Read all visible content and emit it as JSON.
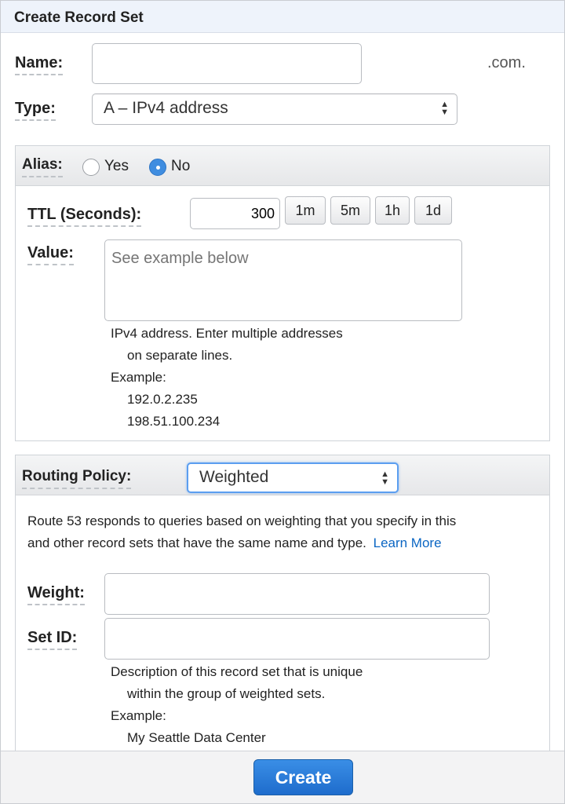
{
  "dialog": {
    "title": "Create Record Set"
  },
  "name": {
    "label": "Name:",
    "value": "",
    "placeholder": "",
    "suffix": ".com."
  },
  "type": {
    "label": "Type:",
    "selected": "A – IPv4 address"
  },
  "alias": {
    "label": "Alias:",
    "yes_label": "Yes",
    "no_label": "No",
    "selected": "No"
  },
  "ttl": {
    "label": "TTL (Seconds):",
    "value": "300",
    "buttons": [
      "1m",
      "5m",
      "1h",
      "1d"
    ]
  },
  "value": {
    "label": "Value:",
    "placeholder": "See example below",
    "help_line1": "IPv4 address. Enter multiple addresses",
    "help_line2": "on separate lines.",
    "example_label": "Example:",
    "example_lines": [
      "192.0.2.235",
      "198.51.100.234"
    ]
  },
  "routing": {
    "label": "Routing Policy:",
    "selected": "Weighted",
    "description_line1": "Route 53 responds to queries based on weighting that you specify in this",
    "description_line2": "and other record sets that have the same name and type.",
    "learn_more": "Learn More"
  },
  "weight": {
    "label": "Weight:",
    "value": ""
  },
  "set_id": {
    "label": "Set ID:",
    "value": "",
    "help_line1": "Description of this record set that is unique",
    "help_line2": "within the group of weighted sets.",
    "example_label": "Example:",
    "example_value": "My Seattle Data Center"
  },
  "footer": {
    "create_label": "Create"
  },
  "colors": {
    "accent": "#1e6ccc",
    "link": "#0b66c3",
    "header_bg": "#eef3fb",
    "focus": "#5b9ef0"
  }
}
